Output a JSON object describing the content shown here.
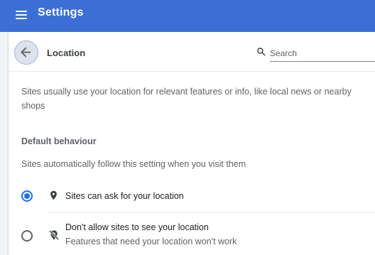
{
  "header": {
    "app_title": "Settings",
    "bar_color": "#3b6fd6",
    "menu_icon": "hamburger-menu-icon"
  },
  "page": {
    "title": "Location",
    "back_icon": "arrow-left-icon"
  },
  "search": {
    "placeholder": "Search",
    "value": "",
    "icon": "magnifier-icon"
  },
  "content": {
    "description": "Sites usually use your location for relevant features or info, like local news or nearby shops",
    "default_heading": "Default behaviour",
    "default_subtext": "Sites automatically follow this setting when you visit them"
  },
  "options": [
    {
      "label": "Sites can ask for your location",
      "sublabel": "",
      "selected": true,
      "icon": "location-pin-icon"
    },
    {
      "label": "Don't allow sites to see your location",
      "sublabel": "Features that need your location won't work",
      "selected": false,
      "icon": "location-off-icon"
    }
  ],
  "accent_color": "#1a73e8"
}
